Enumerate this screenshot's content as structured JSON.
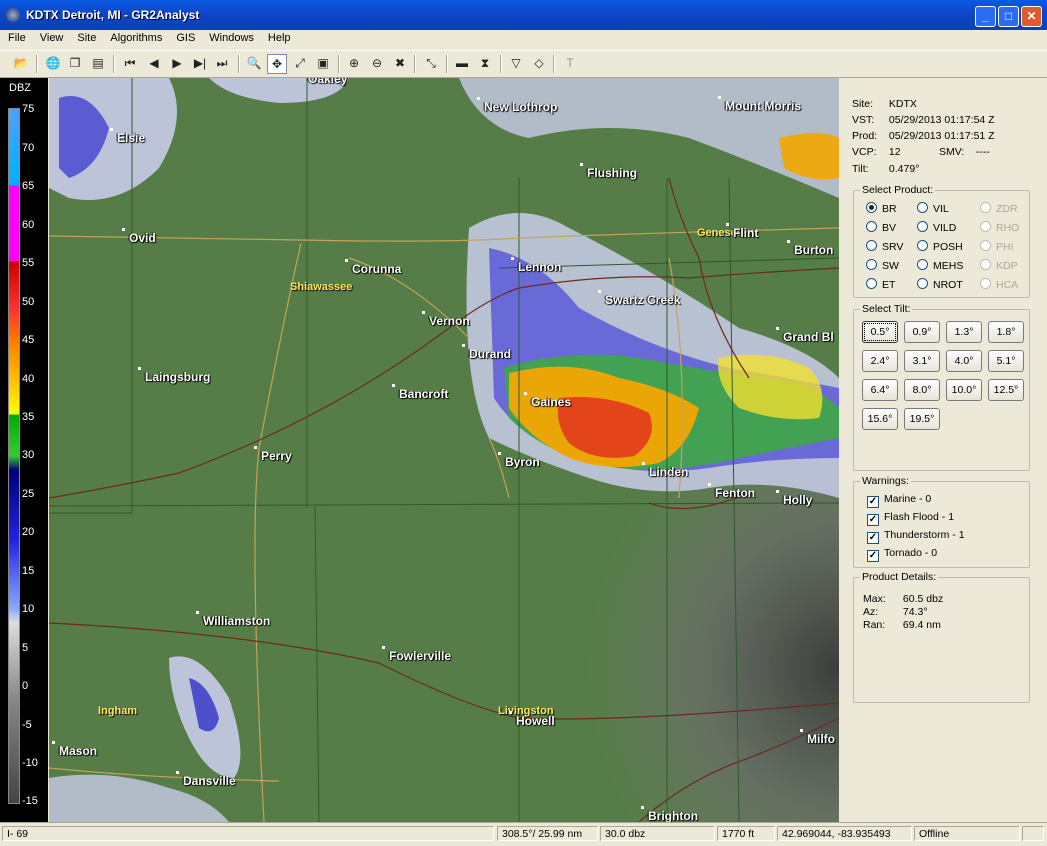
{
  "window": {
    "title": "KDTX Detroit, MI - GR2Analyst",
    "minimize": "_",
    "maximize": "□",
    "close": "✕"
  },
  "menu": [
    "File",
    "View",
    "Site",
    "Algorithms",
    "GIS",
    "Windows",
    "Help"
  ],
  "toolbar": {
    "icons": [
      "open-icon",
      "globe-icon",
      "copy-icon",
      "layers-icon",
      "first-frame-icon",
      "prev-frame-icon",
      "play-icon",
      "next-frame-icon",
      "last-frame-icon",
      "magnifier-icon",
      "pan-icon",
      "measure-icon",
      "window-icon",
      "zoom-in-icon",
      "zoom-out-icon",
      "zoom-reset-icon",
      "cross-section-icon",
      "rectangle-icon",
      "vertical-profile-icon",
      "triangle-marker-icon",
      "diamond-marker-icon",
      "text-icon"
    ],
    "glyphs": [
      "📂",
      "🌐",
      "❐",
      "▤",
      "⏮",
      "◀",
      "▶",
      "▶|",
      "⏭",
      "🔍",
      "✥",
      "⤢",
      "▣",
      "⊕",
      "⊖",
      "✖",
      "⤡",
      "▬",
      "⧗",
      "▽",
      "◇",
      "T"
    ]
  },
  "legend": {
    "title": "DBZ",
    "ticks": [
      "75",
      "70",
      "65",
      "60",
      "55",
      "50",
      "45",
      "40",
      "35",
      "30",
      "25",
      "20",
      "15",
      "10",
      "5",
      "0",
      "-5",
      "-10",
      "-15"
    ]
  },
  "map": {
    "cities": [
      {
        "name": "Oakley"
      },
      {
        "name": "New Lothrop"
      },
      {
        "name": "Mount Morris"
      },
      {
        "name": "Elsie"
      },
      {
        "name": "Flushing"
      },
      {
        "name": "Ovid"
      },
      {
        "name": "Flint"
      },
      {
        "name": "Burton"
      },
      {
        "name": "Corunna"
      },
      {
        "name": "Lennon"
      },
      {
        "name": "Swartz Creek"
      },
      {
        "name": "Vernon"
      },
      {
        "name": "Grand Bl"
      },
      {
        "name": "Durand"
      },
      {
        "name": "Laingsburg"
      },
      {
        "name": "Bancroft"
      },
      {
        "name": "Gaines"
      },
      {
        "name": "Perry"
      },
      {
        "name": "Byron"
      },
      {
        "name": "Linden"
      },
      {
        "name": "Fenton"
      },
      {
        "name": "Holly"
      },
      {
        "name": "Williamston"
      },
      {
        "name": "Fowlerville"
      },
      {
        "name": "Howell"
      },
      {
        "name": "Mason"
      },
      {
        "name": "Dansville"
      },
      {
        "name": "Milfo"
      },
      {
        "name": "Brighton"
      }
    ],
    "counties": [
      "Shiawassee",
      "Genesee",
      "Ingham",
      "Livingston"
    ]
  },
  "panel": {
    "site": {
      "label": "Site:",
      "value": "KDTX"
    },
    "vst": {
      "label": "VST:",
      "value": "05/29/2013  01:17:54 Z"
    },
    "prod": {
      "label": "Prod:",
      "value": "05/29/2013  01:17:51 Z"
    },
    "vcp": {
      "label": "VCP:",
      "value": "12"
    },
    "smv": {
      "label": "SMV:",
      "value": "----"
    },
    "tilt": {
      "label": "Tilt:",
      "value": "0.479°"
    },
    "select_product": {
      "title": "Select Product:",
      "selected": "BR",
      "col1": [
        "BR",
        "BV",
        "SRV",
        "SW",
        "ET"
      ],
      "col2": [
        "VIL",
        "VILD",
        "POSH",
        "MEHS",
        "NROT"
      ],
      "col3": [
        "ZDR",
        "RHO",
        "PHI",
        "KDP",
        "HCA"
      ]
    },
    "select_tilt": {
      "title": "Select Tilt:",
      "selected": "0.5°",
      "tilts": [
        "0.5°",
        "0.9°",
        "1.3°",
        "1.8°",
        "2.4°",
        "3.1°",
        "4.0°",
        "5.1°",
        "6.4°",
        "8.0°",
        "10.0°",
        "12.5°",
        "15.6°",
        "19.5°"
      ]
    },
    "warnings": {
      "title": "Warnings:",
      "items": [
        {
          "label": "Marine - 0",
          "checked": true
        },
        {
          "label": "Flash Flood - 1",
          "checked": true
        },
        {
          "label": "Thunderstorm - 1",
          "checked": true
        },
        {
          "label": "Tornado - 0",
          "checked": true
        }
      ],
      "check_glyph": "✓"
    },
    "details": {
      "title": "Product Details:",
      "max": {
        "label": "Max:",
        "value": "60.5 dbz"
      },
      "az": {
        "label": "Az:",
        "value": "74.3°"
      },
      "ran": {
        "label": "Ran:",
        "value": "69.4 nm"
      }
    }
  },
  "status": {
    "highway": "I- 69",
    "polar": "308.5°/ 25.99 nm",
    "value": "30.0 dbz",
    "height": "1770 ft",
    "latlon": "42.969044, -83.935493",
    "conn": "Offline"
  },
  "colors": {
    "map_bg": "#567d47",
    "titlebar": "#0a47c9",
    "county_label": "#ffe860"
  }
}
